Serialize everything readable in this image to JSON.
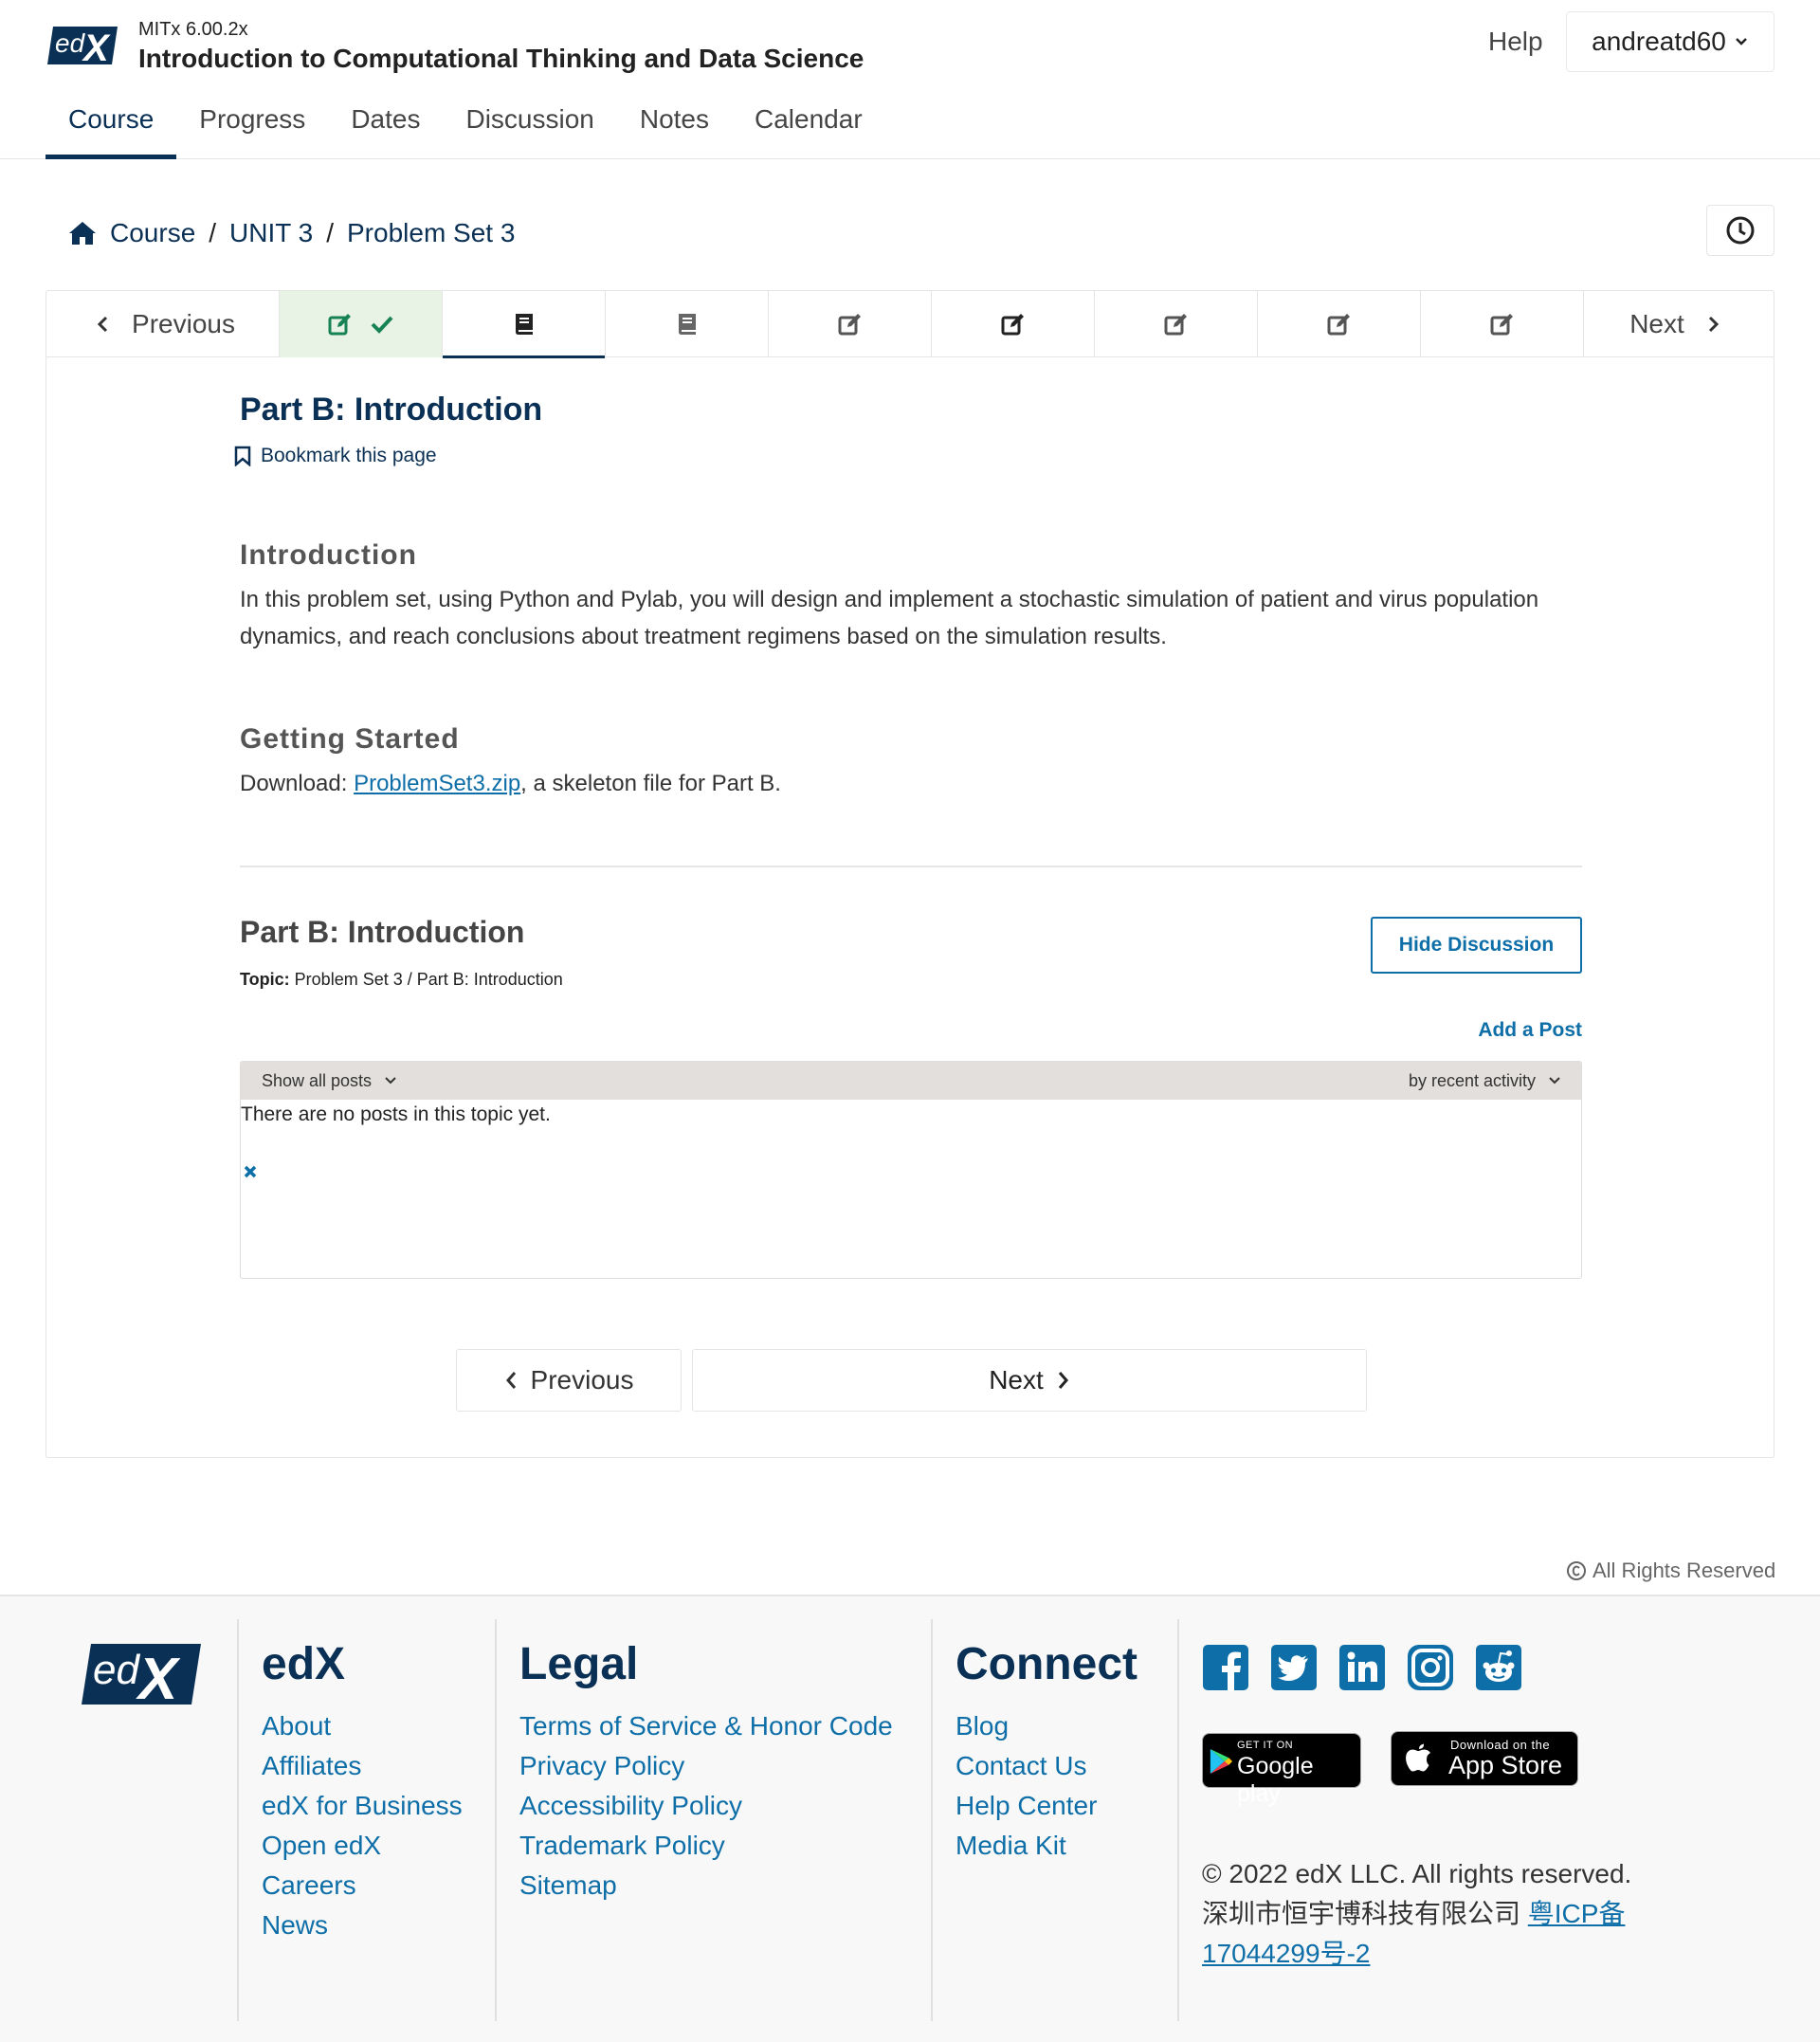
{
  "header": {
    "course_org": "MITx 6.00.2x",
    "course_title": "Introduction to Computational Thinking and Data Science",
    "help_label": "Help",
    "username": "andreatd60",
    "tabs": [
      {
        "label": "Course",
        "active": true
      },
      {
        "label": "Progress",
        "active": false
      },
      {
        "label": "Dates",
        "active": false
      },
      {
        "label": "Discussion",
        "active": false
      },
      {
        "label": "Notes",
        "active": false
      },
      {
        "label": "Calendar",
        "active": false
      }
    ]
  },
  "breadcrumb": {
    "items": [
      "Course",
      "UNIT 3",
      "Problem Set 3"
    ],
    "separator": "/"
  },
  "sequence_nav": {
    "previous_label": "Previous",
    "next_label": "Next",
    "units": [
      {
        "icon": "edit-check-icon",
        "state": "complete"
      },
      {
        "icon": "book-icon",
        "state": "active"
      },
      {
        "icon": "book-icon",
        "state": "normal"
      },
      {
        "icon": "edit-icon",
        "state": "normal"
      },
      {
        "icon": "edit-icon",
        "state": "normal"
      },
      {
        "icon": "edit-icon",
        "state": "normal"
      },
      {
        "icon": "edit-icon",
        "state": "normal"
      },
      {
        "icon": "edit-icon",
        "state": "normal"
      }
    ]
  },
  "unit": {
    "title": "Part B: Introduction",
    "bookmark_label": "Bookmark this page",
    "intro_heading": "Introduction",
    "intro_text": "In this problem set, using Python and Pylab, you will design and implement a stochastic simulation of patient and virus population dynamics, and reach conclusions about treatment regimens based on the simulation results.",
    "getting_started_heading": "Getting Started",
    "download_prefix": "Download: ",
    "download_link": "ProblemSet3.zip",
    "download_suffix": ", a skeleton file for Part B."
  },
  "discussion": {
    "title": "Part B: Introduction",
    "topic_label": "Topic:",
    "topic_value": "Problem Set 3 / Part B: Introduction",
    "hide_button": "Hide Discussion",
    "add_post": "Add a Post",
    "filter_label": "Show all posts",
    "sort_label": "by recent activity",
    "empty_text": "There are no posts in this topic yet."
  },
  "bottom_nav": {
    "previous_label": "Previous",
    "next_label": "Next"
  },
  "rights_label": "All Rights Reserved",
  "footer": {
    "edx_heading": "edX",
    "edx_links": [
      "About",
      "Affiliates",
      "edX for Business",
      "Open edX",
      "Careers",
      "News"
    ],
    "legal_heading": "Legal",
    "legal_links": [
      "Terms of Service & Honor Code",
      "Privacy Policy",
      "Accessibility Policy",
      "Trademark Policy",
      "Sitemap"
    ],
    "connect_heading": "Connect",
    "connect_links": [
      "Blog",
      "Contact Us",
      "Help Center",
      "Media Kit"
    ],
    "social_icons": [
      "facebook-icon",
      "twitter-icon",
      "linkedin-icon",
      "instagram-icon",
      "reddit-icon"
    ],
    "google_play_small": "GET IT ON",
    "google_play_big": "Google play",
    "app_store_small": "Download on the",
    "app_store_big": "App Store",
    "copyright_line": "© 2022 edX LLC. All rights reserved.",
    "icp_company": "深圳市恒宇博科技有限公司 ",
    "icp_link": "粤ICP备17044299号-2"
  },
  "colors": {
    "brand_dark": "#0a3055",
    "link_blue": "#0e6ea8",
    "complete_bg": "#e8f3e6",
    "complete_icon": "#178253"
  }
}
